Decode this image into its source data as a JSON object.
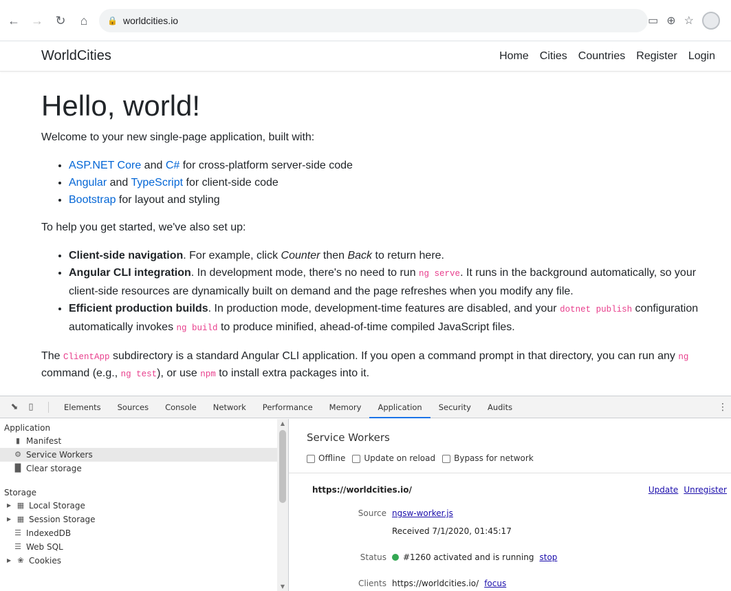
{
  "browser": {
    "url": "worldcities.io",
    "icons": [
      "back-icon",
      "forward-icon",
      "reload-icon",
      "home-icon",
      "lock-icon",
      "cast-icon",
      "add-icon",
      "star-icon",
      "profile-icon"
    ]
  },
  "navbar": {
    "brand": "WorldCities",
    "links": [
      "Home",
      "Cities",
      "Countries",
      "Register",
      "Login"
    ]
  },
  "main": {
    "title": "Hello, world!",
    "intro": "Welcome to your new single-page application, built with:",
    "built_with": [
      {
        "link1": "ASP.NET Core",
        "mid": " and ",
        "link2": "C#",
        "rest": " for cross-platform server-side code"
      },
      {
        "link1": "Angular",
        "mid": " and ",
        "link2": "TypeScript",
        "rest": " for client-side code"
      },
      {
        "link1": "Bootstrap",
        "mid": "",
        "link2": "",
        "rest": " for layout and styling"
      }
    ],
    "setup_intro": "To help you get started, we've also set up:",
    "setup": {
      "nav_bold": "Client-side navigation",
      "nav_text1": ". For example, click ",
      "nav_em1": "Counter",
      "nav_text2": " then ",
      "nav_em2": "Back",
      "nav_text3": " to return here.",
      "cli_bold": "Angular CLI integration",
      "cli_text1": ". In development mode, there's no need to run ",
      "cli_code": "ng serve",
      "cli_text2": ". It runs in the background automatically, so your client-side resources are dynamically built on demand and the page refreshes when you modify any file.",
      "prod_bold": "Efficient production builds",
      "prod_text1": ". In production mode, development-time features are disabled, and your ",
      "prod_code1": "dotnet publish",
      "prod_text2": " configuration automatically invokes ",
      "prod_code2": "ng build",
      "prod_text3": " to produce minified, ahead-of-time compiled JavaScript files."
    },
    "footer": {
      "t1": "The ",
      "c1": "ClientApp",
      "t2": " subdirectory is a standard Angular CLI application. If you open a command prompt in that directory, you can run any ",
      "c2": "ng",
      "t3": " command (e.g., ",
      "c3": "ng test",
      "t4": "), or use ",
      "c4": "npm",
      "t5": " to install extra packages into it."
    }
  },
  "devtools": {
    "tabs": [
      "Elements",
      "Sources",
      "Console",
      "Network",
      "Performance",
      "Memory",
      "Application",
      "Security",
      "Audits"
    ],
    "active_tab": "Application",
    "sidebar": {
      "application_header": "Application",
      "application_items": [
        "Manifest",
        "Service Workers",
        "Clear storage"
      ],
      "selected_item": "Service Workers",
      "storage_header": "Storage",
      "storage_items": [
        "Local Storage",
        "Session Storage",
        "IndexedDB",
        "Web SQL",
        "Cookies"
      ]
    },
    "panel": {
      "title": "Service Workers",
      "options": [
        "Offline",
        "Update on reload",
        "Bypass for network"
      ],
      "origin": "https://worldcities.io/",
      "actions": [
        "Update",
        "Unregister"
      ],
      "source_label": "Source",
      "source_link": "ngsw-worker.js",
      "received": "Received 7/1/2020, 01:45:17",
      "status_label": "Status",
      "status_text": "#1260 activated and is running",
      "status_action": "stop",
      "clients_label": "Clients",
      "clients_value": "https://worldcities.io/",
      "clients_action": "focus"
    },
    "colors": {
      "status_dot": "#34a853",
      "active_tab_underline": "#1a73e8"
    }
  }
}
